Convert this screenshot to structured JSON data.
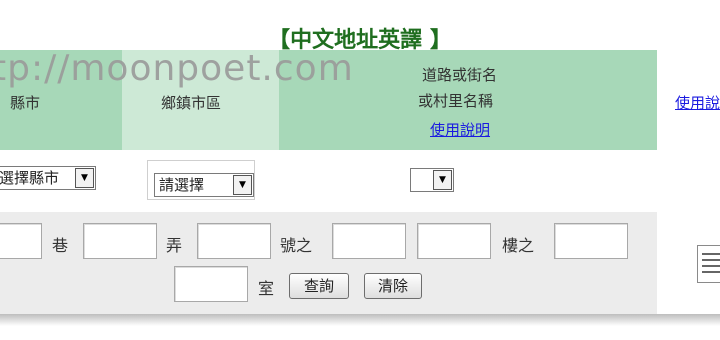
{
  "title": "【中文地址英譯 】",
  "watermark": "tp://moonpoet.com",
  "header": {
    "col1_label": "縣市",
    "col2_label": "鄉鎮市區",
    "col3_label_line1": "道路或街名",
    "col3_label_line2": "或村里名稱",
    "col3_link": "使用說明",
    "col4_link": "使用說"
  },
  "selects": {
    "county": "選擇縣市",
    "district": "請選擇",
    "road": ""
  },
  "fields": {
    "lane_label": "巷",
    "alley_label": "弄",
    "number_label": "號之",
    "floor_label": "樓之",
    "room_label": "室"
  },
  "buttons": {
    "query": "查詢",
    "clear": "清除"
  },
  "colors": {
    "title": "#1f6e1f",
    "header_dark": "#a7d8b8",
    "header_light": "#cde9d6",
    "link": "#1a1ae0",
    "form_bg": "#ececec"
  },
  "icons": {
    "dropdown": "triangle-down",
    "document": "document-icon"
  }
}
